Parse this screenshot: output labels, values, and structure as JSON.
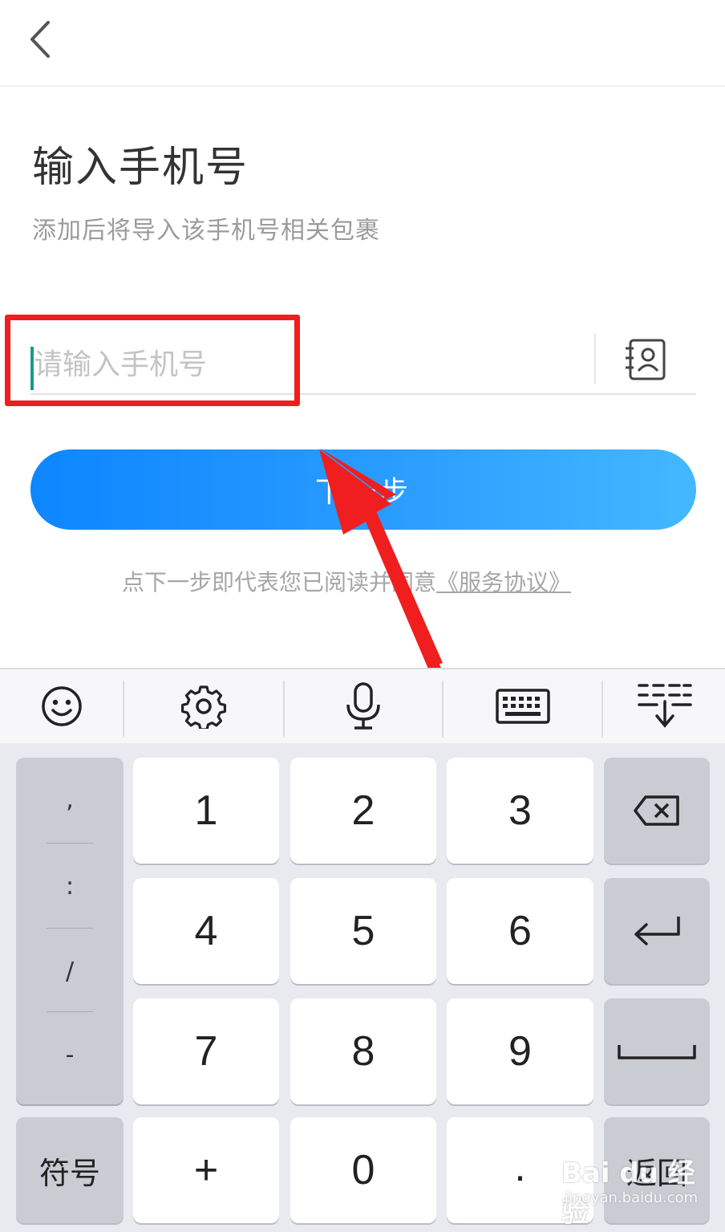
{
  "page": {
    "title": "输入手机号",
    "subtitle": "添加后将导入该手机号相关包裹"
  },
  "phone_input": {
    "placeholder": "请输入手机号",
    "value": ""
  },
  "next_button": {
    "label": "下一步"
  },
  "agreement": {
    "text": "点下一步即代表您已阅读并同意",
    "link": "《服务协议》"
  },
  "keyboard": {
    "toolbar": [
      "emoji-icon",
      "settings-gear-icon",
      "microphone-icon",
      "keyboard-icon",
      "hide-keyboard-icon"
    ],
    "symbols": [
      ",",
      ":",
      "/",
      "-"
    ],
    "digits": [
      [
        "1",
        "2",
        "3"
      ],
      [
        "4",
        "5",
        "6"
      ],
      [
        "7",
        "8",
        "9"
      ]
    ],
    "bottom": {
      "symbol_label": "符号",
      "plus": "+",
      "zero": "0",
      "dot": ".",
      "return_label": "返回"
    }
  },
  "watermark": {
    "brand": "Bai du 经验",
    "url": "jingyan.baidu.com"
  },
  "colors": {
    "accent_start": "#0d86ff",
    "accent_end": "#44b8ff",
    "annotation_red": "#f01e1e",
    "cursor": "#1a9a8a"
  }
}
